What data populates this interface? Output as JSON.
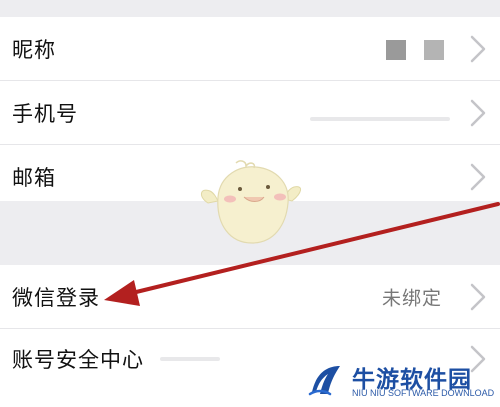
{
  "settings": {
    "rows": [
      {
        "label": "昵称",
        "value": ""
      },
      {
        "label": "手机号",
        "value": ""
      },
      {
        "label": "邮箱",
        "value": ""
      },
      {
        "label": "微信登录",
        "value": "未绑定"
      },
      {
        "label": "账号安全中心",
        "value": ""
      }
    ]
  },
  "watermark": {
    "title": "牛游软件园",
    "subtitle": "NIU NIU SOFTWARE DOWNLOAD"
  },
  "colors": {
    "arrow": "#b3201f",
    "brand": "#1d4fa3",
    "row_bg": "#ffffff",
    "page_bg": "#efeff2"
  },
  "icons": [
    "chevron-right-icon",
    "mascot-chick-icon",
    "red-arrow-annotation",
    "niuyou-logo-icon"
  ]
}
